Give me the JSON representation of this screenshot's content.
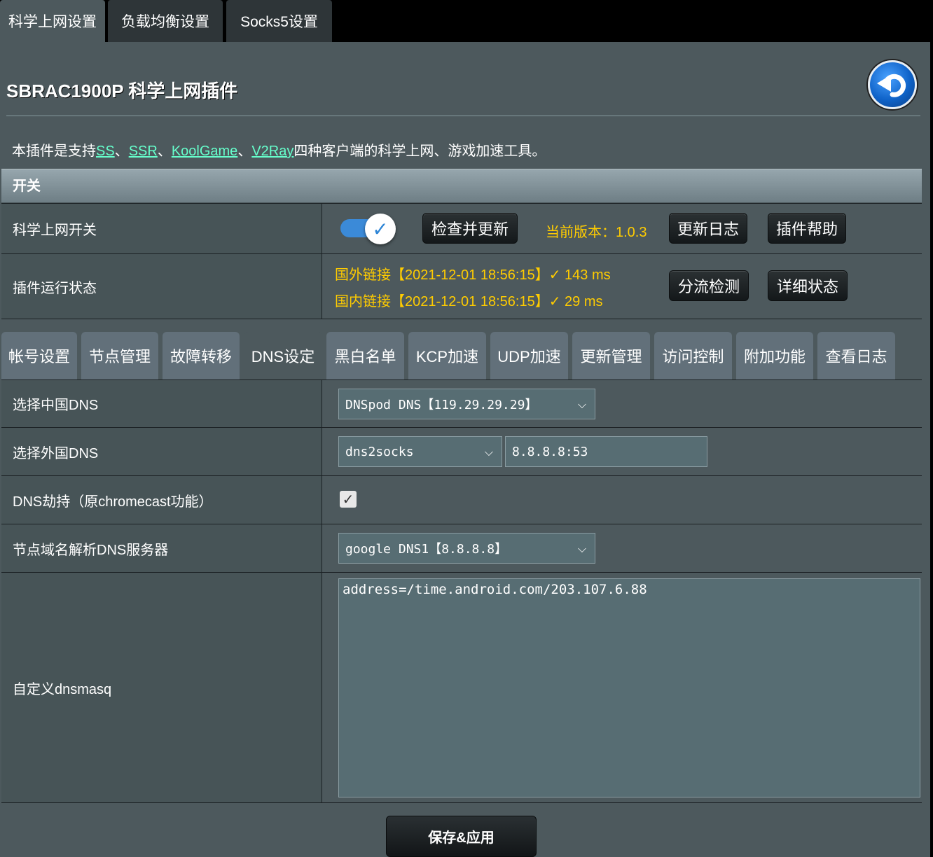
{
  "top_tabs": [
    "科学上网设置",
    "负载均衡设置",
    "Socks5设置"
  ],
  "title": "SBRAC1900P 科学上网插件",
  "intro": {
    "prefix": "本插件是支持",
    "links": [
      "SS",
      "SSR",
      "KoolGame",
      "V2Ray"
    ],
    "separator": "、",
    "suffix": "四种客户端的科学上网、游戏加速工具。"
  },
  "section_header": "开关",
  "switch_row": {
    "label": "科学上网开关",
    "toggle_on": true,
    "check_update_button": "检查并更新",
    "version_text": "当前版本：1.0.3",
    "changelog_button": "更新日志",
    "help_button": "插件帮助"
  },
  "status_row": {
    "label": "插件运行状态",
    "foreign_status": "国外链接【2021-12-01 18:56:15】✓  143 ms",
    "domestic_status": "国内链接【2021-12-01 18:56:15】✓  29 ms",
    "split_check_button": "分流检测",
    "detail_button": "详细状态"
  },
  "sub_tabs": [
    "帐号设置",
    "节点管理",
    "故障转移",
    "DNS设定",
    "黑白名单",
    "KCP加速",
    "UDP加速",
    "更新管理",
    "访问控制",
    "附加功能",
    "查看日志"
  ],
  "active_sub_tab": "DNS设定",
  "dns": {
    "china_dns_label": "选择中国DNS",
    "china_dns_value": "DNSpod DNS【119.29.29.29】",
    "foreign_dns_label": "选择外国DNS",
    "foreign_dns_mode": "dns2socks",
    "foreign_dns_server": "8.8.8.8:53",
    "hijack_label": "DNS劫持（原chromecast功能）",
    "hijack_checked": true,
    "node_resolve_label": "节点域名解析DNS服务器",
    "node_resolve_value": "google DNS1【8.8.8.8】",
    "dnsmasq_label": "自定义dnsmasq",
    "dnsmasq_value": "address=/time.android.com/203.107.6.88"
  },
  "save_button": "保存&应用",
  "icons": {
    "back": "back-arrow-icon",
    "check": "checkmark-icon",
    "chevron": "chevron-down-icon"
  },
  "colors": {
    "panel": "#4d595d",
    "accent_link": "#66ffcc",
    "status_text": "#ffcc00",
    "toggle_on": "#3b8ad8"
  }
}
